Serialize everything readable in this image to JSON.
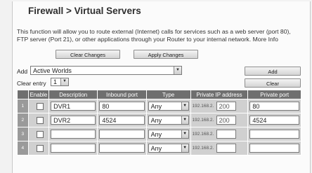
{
  "page": {
    "title": "Firewall > Virtual Servers",
    "description": "This function will allow you to route external (Internet) calls for services such as a web server (port 80), FTP server (Port 21), or other applications through your Router to your internal network. More Info"
  },
  "actions": {
    "clear_changes": "Clear Changes",
    "apply_changes": "Apply Changes"
  },
  "add_row": {
    "label": "Add",
    "selected": "Active Worlds",
    "button": "Add"
  },
  "clear_row": {
    "label": "Clear entry",
    "selected": "1",
    "button": "Clear"
  },
  "table": {
    "headers": [
      "Enable",
      "Description",
      "Inbound port",
      "Type",
      "Private IP address",
      "Private port"
    ],
    "rows": [
      {
        "num": "1",
        "description": "DVR1",
        "inbound": "80",
        "type": "Any",
        "ip_prefix": "192.168.2.",
        "ip_last": "200",
        "private_port": "80"
      },
      {
        "num": "2",
        "description": "DVR2",
        "inbound": "4524",
        "type": "Any",
        "ip_prefix": "192.168.2.",
        "ip_last": "200",
        "private_port": "4524"
      },
      {
        "num": "3",
        "description": "",
        "inbound": "",
        "type": "Any",
        "ip_prefix": "192.168.2.",
        "ip_last": "",
        "private_port": ""
      },
      {
        "num": "4",
        "description": "",
        "inbound": "",
        "type": "Any",
        "ip_prefix": "192.168.2.",
        "ip_last": "",
        "private_port": ""
      }
    ]
  }
}
